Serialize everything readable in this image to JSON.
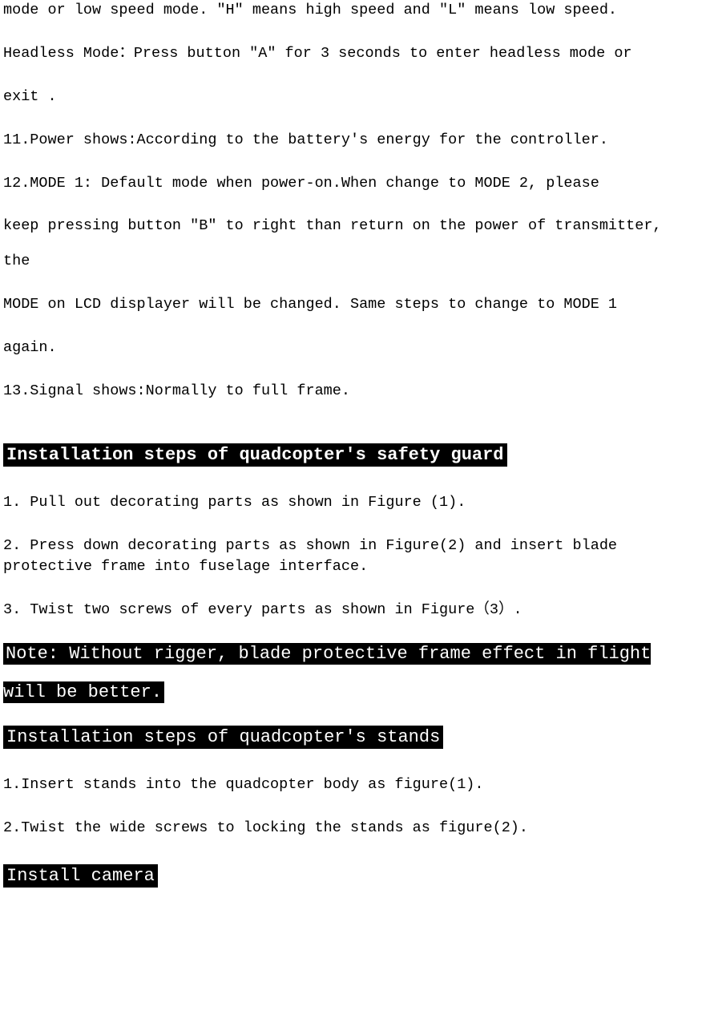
{
  "top_fragment": {
    "line1": "mode or low speed mode. \"H\" means high speed and \"L\" means low speed.",
    "headless": "Headless Mode：Press button \"A\" for 3 seconds to enter headless mode or",
    "exit": "exit .",
    "item11": "11.Power shows:According to the battery's energy for the controller.",
    "item12_a": "12.MODE 1: Default mode when power-on.When change to MODE 2, please",
    "item12_b": "keep pressing button \"B\" to right than return on the power of transmitter,",
    "item12_c": "the",
    "item12_d": "MODE on LCD displayer will be changed. Same steps to change to MODE 1",
    "item12_e": "again.",
    "item13": "13.Signal shows:Normally to full frame."
  },
  "sections": {
    "guard": {
      "heading": "Installation steps of quadcopter's safety guard",
      "step1": "1. Pull out decorating parts as shown in Figure (1).",
      "step2": "2. Press down decorating parts as shown in Figure(2) and insert blade protective frame into fuselage interface.",
      "step3": "3. Twist two screws of every parts as shown in Figure（3）.",
      "note": "Note: Without rigger, blade protective frame effect in flight will be better."
    },
    "stands": {
      "heading": "Installation steps of quadcopter's stands",
      "step1": "1.Insert stands into the quadcopter body as figure(1).",
      "step2": "2.Twist the wide screws to locking the stands as figure(2)."
    },
    "camera": {
      "heading": "Install camera"
    }
  }
}
